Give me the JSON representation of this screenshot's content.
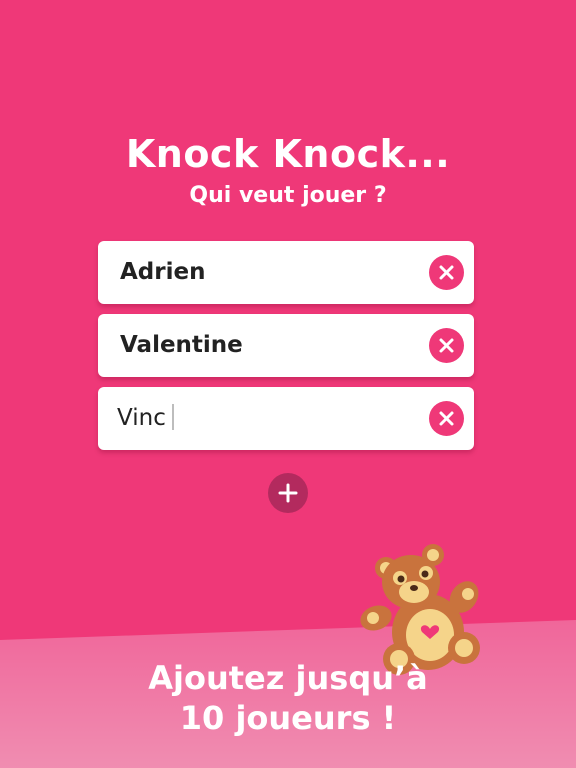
{
  "header": {
    "title": "Knock Knock...",
    "subtitle": "Qui veut jouer ?"
  },
  "players": [
    {
      "name": "Adrien"
    },
    {
      "name": "Valentine"
    },
    {
      "name": "Vinc"
    }
  ],
  "icons": {
    "remove": "close-x-icon",
    "add": "plus-icon",
    "mascot": "teddy-bear-icon"
  },
  "promo": {
    "line1": "Ajoutez jusqu’à",
    "line2": "10 joueurs !"
  },
  "colors": {
    "background": "#ef3878",
    "accent": "#ef3878",
    "add_button": "#b32a5e",
    "bottom_band": "#f18bb0"
  }
}
